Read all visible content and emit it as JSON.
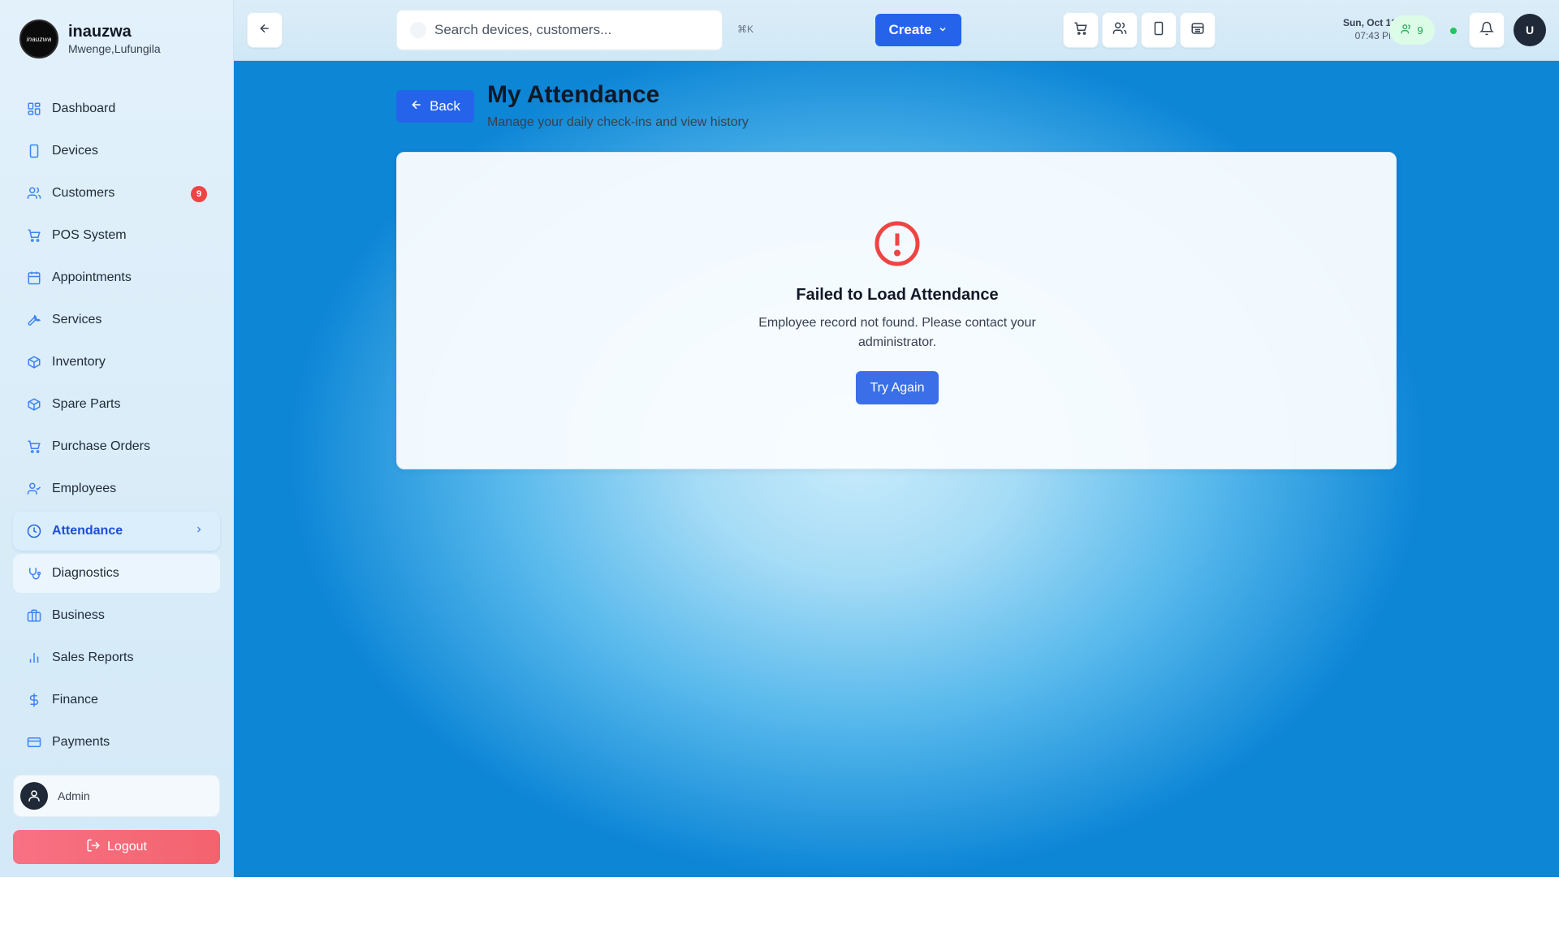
{
  "brand": {
    "logo_text": "inauzwa",
    "name": "inauzwa",
    "subtitle": "Mwenge,Lufungila"
  },
  "sidebar": {
    "items": [
      {
        "label": "Dashboard",
        "icon": "dashboard-icon"
      },
      {
        "label": "Devices",
        "icon": "smartphone-icon"
      },
      {
        "label": "Customers",
        "icon": "users-icon",
        "badge": "9"
      },
      {
        "label": "POS System",
        "icon": "cart-icon"
      },
      {
        "label": "Appointments",
        "icon": "calendar-icon"
      },
      {
        "label": "Services",
        "icon": "wrench-icon"
      },
      {
        "label": "Inventory",
        "icon": "package-icon"
      },
      {
        "label": "Spare Parts",
        "icon": "package-icon"
      },
      {
        "label": "Purchase Orders",
        "icon": "cart-icon"
      },
      {
        "label": "Employees",
        "icon": "user-check-icon"
      },
      {
        "label": "Attendance",
        "icon": "clock-icon",
        "active": true
      },
      {
        "label": "Diagnostics",
        "icon": "stethoscope-icon"
      },
      {
        "label": "Business",
        "icon": "briefcase-icon"
      },
      {
        "label": "Sales Reports",
        "icon": "bar-chart-icon"
      },
      {
        "label": "Finance",
        "icon": "dollar-icon"
      },
      {
        "label": "Payments",
        "icon": "credit-card-icon"
      }
    ],
    "user": {
      "name": "Admin"
    },
    "logout_label": "Logout"
  },
  "topbar": {
    "search_placeholder": "Search devices, customers...",
    "shortcut": "⌘K",
    "create_label": "Create",
    "date": "Sun, Oct 12",
    "time": "07:43 PM",
    "online_count": "9",
    "avatar_initial": "U"
  },
  "page": {
    "back_label": "Back",
    "title": "My Attendance",
    "subtitle": "Manage your daily check-ins and view history"
  },
  "error": {
    "title": "Failed to Load Attendance",
    "message": "Employee record not found. Please contact your administrator.",
    "retry_label": "Try Again"
  },
  "colors": {
    "accent": "#2563eb",
    "danger": "#ef4444",
    "logout": "#f3636e",
    "online": "#22c55e"
  }
}
